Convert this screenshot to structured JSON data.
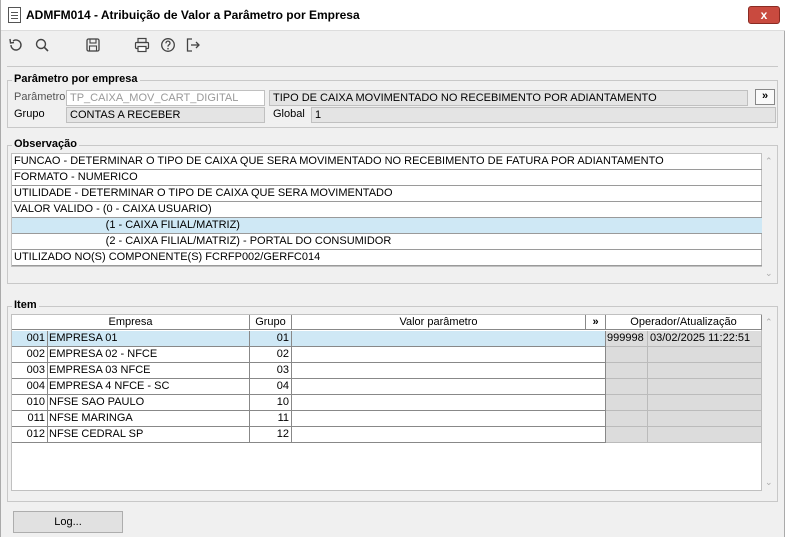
{
  "window": {
    "title": "ADMFM014 - Atribuição de Valor a Parâmetro por Empresa",
    "close_label": "x"
  },
  "toolbar": {
    "icons": [
      "refresh-icon",
      "search-icon",
      "save-icon",
      "print-icon",
      "help-icon",
      "exit-icon"
    ]
  },
  "param_section": {
    "title": "Parâmetro por empresa",
    "param_label": "Parâmetro",
    "param_value": "TP_CAIXA_MOV_CART_DIGITAL",
    "param_description": "TIPO DE CAIXA MOVIMENTADO NO RECEBIMENTO POR ADIANTAMENTO",
    "expand_label": "»",
    "grupo_label": "Grupo",
    "grupo_value": "CONTAS A RECEBER",
    "global_label": "Global",
    "global_value": "1"
  },
  "observacao": {
    "title": "Observação",
    "lines": [
      "FUNCAO - DETERMINAR O TIPO DE CAIXA QUE SERA MOVIMENTADO NO RECEBIMENTO DE FATURA POR ADIANTAMENTO",
      "FORMATO - NUMERICO",
      "UTILIDADE - DETERMINAR O TIPO DE CAIXA QUE SERA MOVIMENTADO",
      "VALOR VALIDO - (0 - CAIXA USUARIO)",
      "                              (1 - CAIXA FILIAL/MATRIZ)",
      "                              (2 - CAIXA FILIAL/MATRIZ) - PORTAL DO CONSUMIDOR",
      "UTILIZADO NO(S) COMPONENTE(S) FCRFP002/GERFC014"
    ],
    "selected_index": 4
  },
  "item": {
    "title": "Item",
    "columns": {
      "empresa": "Empresa",
      "grupo": "Grupo",
      "valor": "Valor parâmetro",
      "expand": "»",
      "operador": "Operador/Atualização"
    },
    "rows": [
      {
        "code": "001",
        "name": "EMPRESA 01",
        "grupo": "01",
        "valor": "",
        "operador": "999998",
        "atualizacao": "03/02/2025 11:22:51"
      },
      {
        "code": "002",
        "name": "EMPRESA 02 - NFCE",
        "grupo": "02",
        "valor": "",
        "operador": "",
        "atualizacao": ""
      },
      {
        "code": "003",
        "name": "EMPRESA 03 NFCE",
        "grupo": "03",
        "valor": "",
        "operador": "",
        "atualizacao": ""
      },
      {
        "code": "004",
        "name": "EMPRESA 4 NFCE - SC",
        "grupo": "04",
        "valor": "",
        "operador": "",
        "atualizacao": ""
      },
      {
        "code": "010",
        "name": "NFSE SAO PAULO",
        "grupo": "10",
        "valor": "",
        "operador": "",
        "atualizacao": ""
      },
      {
        "code": "011",
        "name": "NFSE MARINGA",
        "grupo": "11",
        "valor": "",
        "operador": "",
        "atualizacao": ""
      },
      {
        "code": "012",
        "name": "NFSE CEDRAL SP",
        "grupo": "12",
        "valor": "",
        "operador": "",
        "atualizacao": ""
      }
    ]
  },
  "footer": {
    "log_label": "Log..."
  }
}
